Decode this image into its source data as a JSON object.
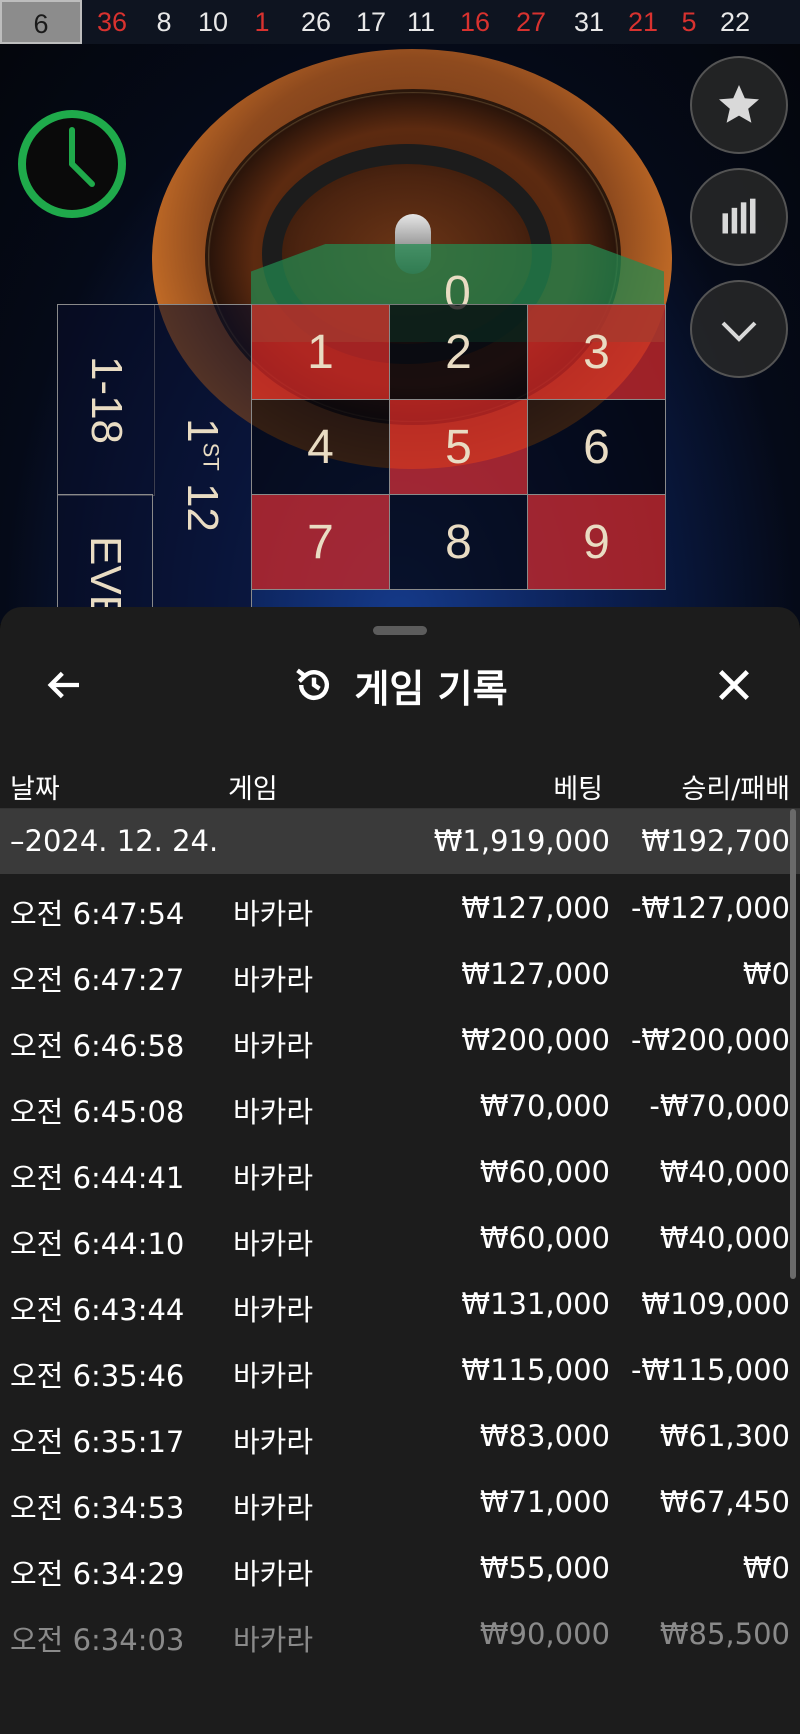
{
  "results_strip": {
    "numbers": [
      {
        "value": "6",
        "color": "black",
        "highlight": true
      },
      {
        "value": "36",
        "color": "red"
      },
      {
        "value": "8",
        "color": "black"
      },
      {
        "value": "10",
        "color": "black"
      },
      {
        "value": "1",
        "color": "red"
      },
      {
        "value": "26",
        "color": "black"
      },
      {
        "value": "17",
        "color": "black"
      },
      {
        "value": "11",
        "color": "black"
      },
      {
        "value": "16",
        "color": "red"
      },
      {
        "value": "27",
        "color": "red"
      },
      {
        "value": "31",
        "color": "black"
      },
      {
        "value": "21",
        "color": "red"
      },
      {
        "value": "5",
        "color": "red"
      },
      {
        "value": "22",
        "color": "black"
      }
    ]
  },
  "table": {
    "zero": "0",
    "cells": [
      {
        "n": "1",
        "c": "red"
      },
      {
        "n": "2",
        "c": "black"
      },
      {
        "n": "3",
        "c": "red"
      },
      {
        "n": "4",
        "c": "black"
      },
      {
        "n": "5",
        "c": "red"
      },
      {
        "n": "6",
        "c": "black"
      },
      {
        "n": "7",
        "c": "red"
      },
      {
        "n": "8",
        "c": "black"
      },
      {
        "n": "9",
        "c": "red"
      }
    ],
    "low_label": "1-18",
    "even_label": "EVE",
    "dozen_label": "1",
    "dozen_sup": "ST",
    "dozen_suffix": " 12"
  },
  "sheet": {
    "title": "게임 기록",
    "columns": {
      "date": "날짜",
      "game": "게임",
      "bet": "베팅",
      "result": "승리/패배"
    },
    "date_group": {
      "date": "–2024. 12. 24.",
      "total_bet": "₩1,919,000",
      "total_result": "₩192,700"
    },
    "rows": [
      {
        "time": "오전 6:47:54",
        "game": "바카라",
        "bet": "₩127,000",
        "result": "-₩127,000"
      },
      {
        "time": "오전 6:47:27",
        "game": "바카라",
        "bet": "₩127,000",
        "result": "₩0"
      },
      {
        "time": "오전 6:46:58",
        "game": "바카라",
        "bet": "₩200,000",
        "result": "-₩200,000"
      },
      {
        "time": "오전 6:45:08",
        "game": "바카라",
        "bet": "₩70,000",
        "result": "-₩70,000"
      },
      {
        "time": "오전 6:44:41",
        "game": "바카라",
        "bet": "₩60,000",
        "result": "₩40,000"
      },
      {
        "time": "오전 6:44:10",
        "game": "바카라",
        "bet": "₩60,000",
        "result": "₩40,000"
      },
      {
        "time": "오전 6:43:44",
        "game": "바카라",
        "bet": "₩131,000",
        "result": "₩109,000"
      },
      {
        "time": "오전 6:35:46",
        "game": "바카라",
        "bet": "₩115,000",
        "result": "-₩115,000"
      },
      {
        "time": "오전 6:35:17",
        "game": "바카라",
        "bet": "₩83,000",
        "result": "₩61,300"
      },
      {
        "time": "오전 6:34:53",
        "game": "바카라",
        "bet": "₩71,000",
        "result": "₩67,450"
      },
      {
        "time": "오전 6:34:29",
        "game": "바카라",
        "bet": "₩55,000",
        "result": "₩0"
      },
      {
        "time": "오전 6:34:03",
        "game": "바카라",
        "bet": "₩90,000",
        "result": "₩85,500"
      }
    ]
  },
  "icons": {
    "clock": "clock-icon",
    "star": "star-icon",
    "stats": "bar-chart-icon",
    "collapse": "chevron-down-icon",
    "back": "arrow-left-icon",
    "history": "history-icon",
    "close": "close-icon"
  },
  "colors": {
    "red": "#d8322f",
    "timer_green": "#1faa4b",
    "sheet_bg": "#1c1c1c",
    "date_row_bg": "#3a3a3a"
  }
}
